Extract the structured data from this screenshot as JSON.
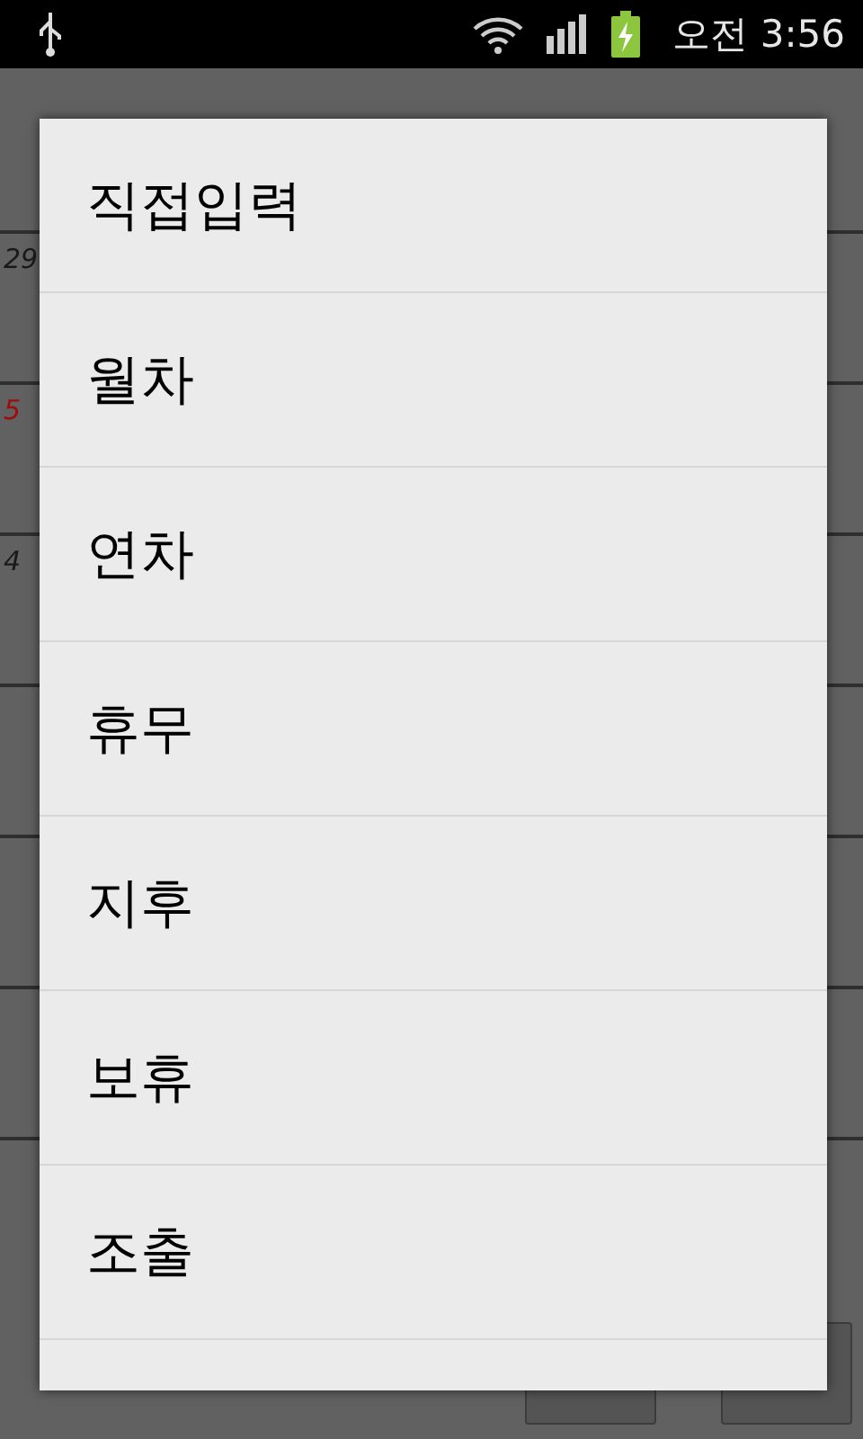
{
  "status_bar": {
    "time": "오전 3:56"
  },
  "calendar": {
    "days": [
      {
        "label": "29",
        "holiday": false
      },
      {
        "label": "5",
        "holiday": true
      },
      {
        "label": "4",
        "holiday": false
      }
    ]
  },
  "dialog": {
    "items": [
      "직접입력",
      "월차",
      "연차",
      "휴무",
      "지후",
      "보휴",
      "조출"
    ]
  }
}
